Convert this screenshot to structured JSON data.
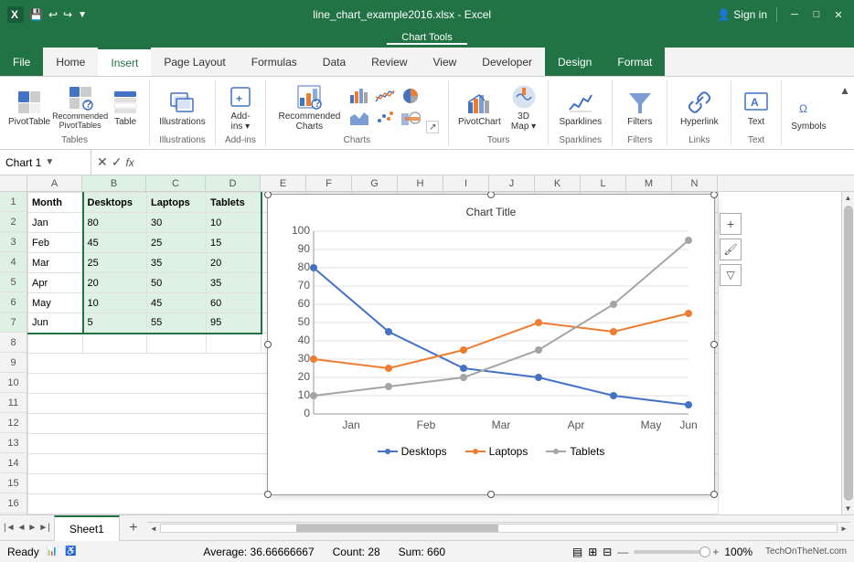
{
  "window": {
    "title": "line_chart_example2016.xlsx - Excel",
    "chart_tools": "Chart Tools",
    "sign_in": "Sign in"
  },
  "ribbon": {
    "tabs": [
      "File",
      "Home",
      "Insert",
      "Page Layout",
      "Formulas",
      "Data",
      "Review",
      "View",
      "Developer",
      "Design",
      "Format"
    ],
    "active_tab": "Insert",
    "active_design": "Design",
    "active_format": "Format",
    "groups": {
      "tables": {
        "label": "Tables",
        "buttons": [
          "PivotTable",
          "Recommended\nPivotTables",
          "Table"
        ]
      },
      "illustrations": {
        "label": "Illustrations",
        "buttons": [
          "Illustrations"
        ]
      },
      "charts": {
        "label": "Charts",
        "buttons": [
          "Recommended\nCharts"
        ]
      },
      "tours": {
        "label": "Tours",
        "buttons": [
          "3D\nMap"
        ]
      },
      "sparklines": {
        "label": "Sparklines",
        "buttons": [
          "Sparklines"
        ]
      },
      "filters": {
        "label": "Filters",
        "buttons": [
          "Filters"
        ]
      },
      "links": {
        "label": "Links",
        "buttons": [
          "Hyperlink"
        ]
      },
      "text_group": {
        "label": "Text",
        "buttons": [
          "Text"
        ]
      },
      "symbols": {
        "label": "",
        "buttons": [
          "Symbols"
        ]
      }
    }
  },
  "name_box": {
    "value": "Chart 1"
  },
  "formula_bar": {
    "value": ""
  },
  "columns": {
    "headers": [
      "A",
      "B",
      "C",
      "D",
      "E",
      "F",
      "G",
      "H",
      "I",
      "J",
      "K",
      "L",
      "M",
      "N"
    ],
    "widths": [
      60,
      70,
      65,
      60,
      50,
      50,
      50,
      50,
      50,
      50,
      50,
      50,
      50,
      50
    ]
  },
  "rows": {
    "count": 16
  },
  "table": {
    "headers": [
      "Month",
      "Desktops",
      "Laptops",
      "Tablets"
    ],
    "data": [
      [
        "Jan",
        "80",
        "30",
        "10"
      ],
      [
        "Feb",
        "45",
        "25",
        "15"
      ],
      [
        "Mar",
        "25",
        "35",
        "20"
      ],
      [
        "Apr",
        "20",
        "50",
        "35"
      ],
      [
        "May",
        "10",
        "45",
        "60"
      ],
      [
        "Jun",
        "5",
        "55",
        "95"
      ]
    ]
  },
  "chart": {
    "title": "Chart Title",
    "series": [
      {
        "name": "Desktops",
        "color": "#4472C4",
        "values": [
          80,
          45,
          25,
          20,
          10,
          5
        ]
      },
      {
        "name": "Laptops",
        "color": "#ED7D31",
        "values": [
          30,
          25,
          35,
          50,
          45,
          55
        ]
      },
      {
        "name": "Tablets",
        "color": "#A5A5A5",
        "values": [
          10,
          15,
          20,
          35,
          60,
          95
        ]
      }
    ],
    "x_labels": [
      "Jan",
      "Feb",
      "Mar",
      "Apr",
      "May",
      "Jun"
    ],
    "y_max": 100,
    "y_step": 10
  },
  "sheet_tabs": [
    "Sheet1"
  ],
  "status": {
    "ready": "Ready",
    "average": "Average: 36.66666667",
    "count": "Count: 28",
    "sum": "Sum: 660",
    "zoom": "100%"
  },
  "watermark": "TechOnTheNet.com"
}
